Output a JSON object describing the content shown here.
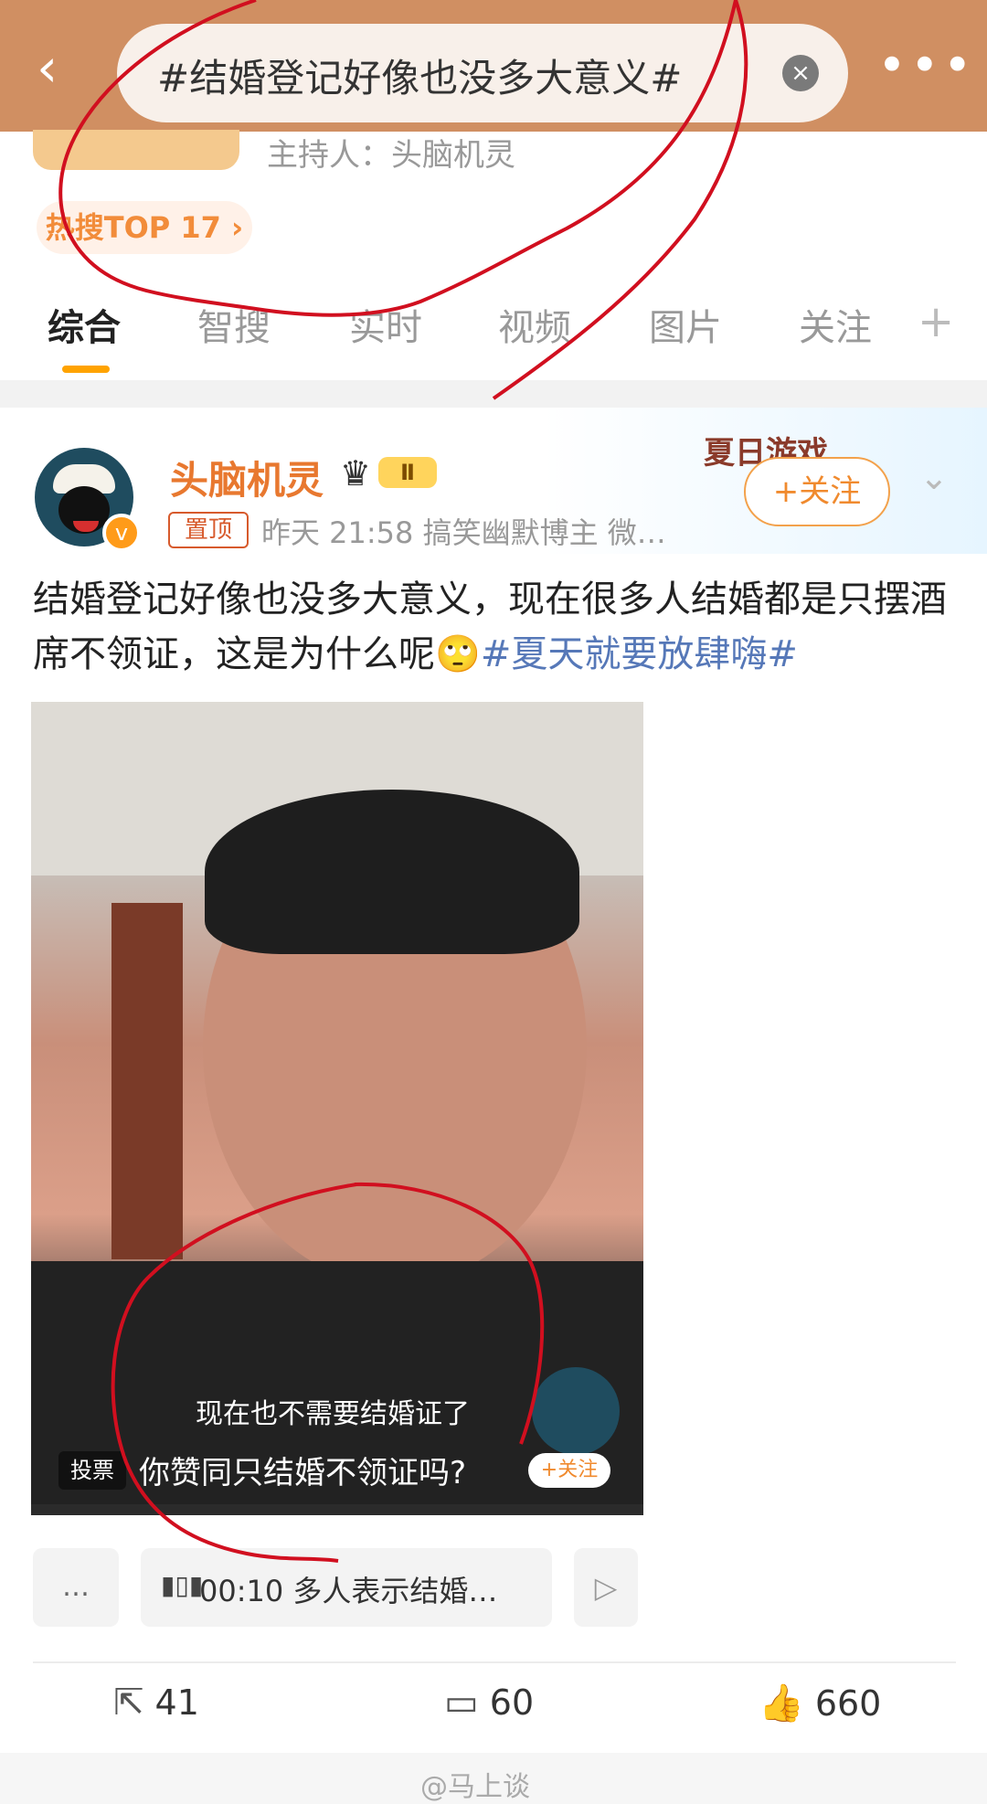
{
  "search": {
    "query": "#结婚登记好像也没多大意义#",
    "clear_icon": "close-icon"
  },
  "header": {
    "back_icon": "chevron-left-icon",
    "more_icon": "more-icon",
    "host_label": "主持人：头脑机灵",
    "hot_label": "热搜TOP 17 ›"
  },
  "tabs": [
    "综合",
    "智搜",
    "实时",
    "视频",
    "图片",
    "关注"
  ],
  "post": {
    "username": "头脑机灵",
    "level": "Ⅱ",
    "pin_label": "置顶",
    "meta": "昨天 21:58   搞笑幽默博主 微…",
    "summer_label": "夏日游戏",
    "follow_label": "+关注",
    "content_text": "结婚登记好像也没多大意义，现在很多人结婚都是只摆酒席不领证，这是为什么呢🙄",
    "topic": "#夏天就要放肆嗨#",
    "video": {
      "subtitle": "现在也不需要结婚证了",
      "vote_tag": "投票",
      "vote_question": "你赞同只结婚不领证吗?",
      "mini_follow": "+关注"
    },
    "clips": {
      "left": "…",
      "main": "00:10  多人表示结婚…",
      "right": "▷"
    },
    "actions": {
      "share_count": "41",
      "comment_count": "60",
      "like_count": "660"
    }
  },
  "watermark": "@马上谈",
  "colors": {
    "topbar": "#d08f62",
    "accent": "#f08a2e",
    "topic": "#5678b8",
    "annotation": "#d10f1f"
  }
}
